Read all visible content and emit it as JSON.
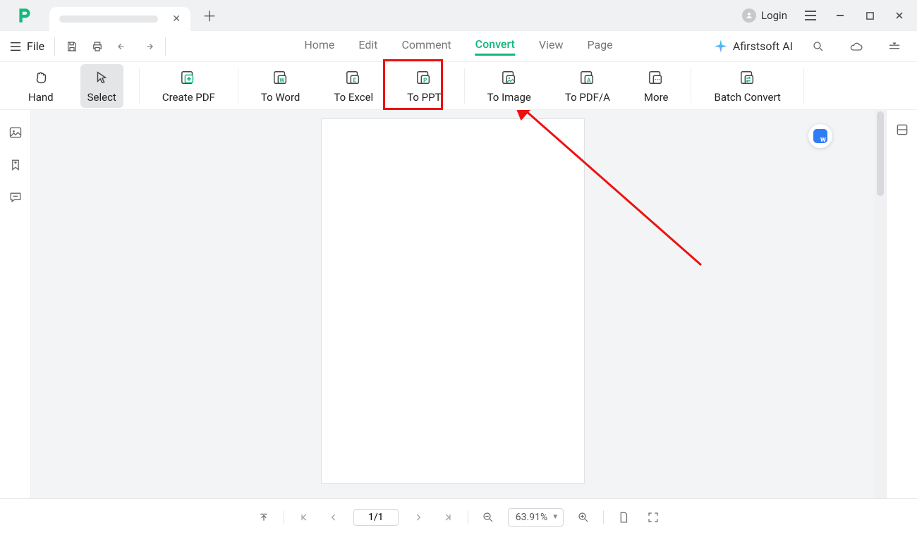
{
  "titlebar": {
    "login_label": "Login"
  },
  "menubar": {
    "file_label": "File",
    "tabs": {
      "home": "Home",
      "edit": "Edit",
      "comment": "Comment",
      "convert": "Convert",
      "view": "View",
      "page": "Page"
    },
    "ai_label": "Afirstsoft AI"
  },
  "ribbon": {
    "hand": "Hand",
    "select": "Select",
    "create_pdf": "Create PDF",
    "to_word": "To Word",
    "to_excel": "To Excel",
    "to_ppt": "To PPT",
    "to_image": "To Image",
    "to_pdfa": "To PDF/A",
    "more": "More",
    "batch_convert": "Batch Convert"
  },
  "statusbar": {
    "page_value": "1/1",
    "zoom_value": "63.91%"
  },
  "colors": {
    "accent": "#11b77a",
    "highlight": "#e11"
  }
}
